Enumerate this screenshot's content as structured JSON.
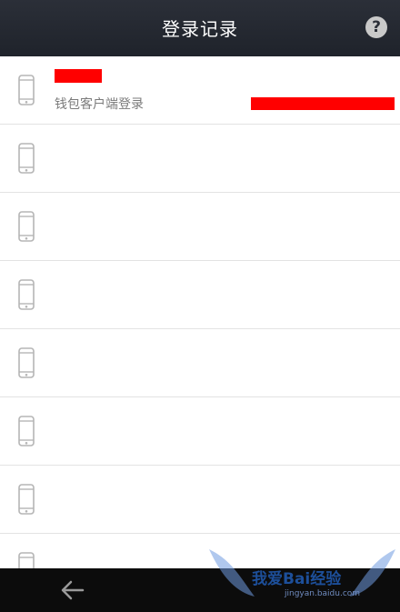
{
  "header": {
    "title": "登录记录",
    "help_label": "?"
  },
  "records": [
    {
      "subtitle": "钱包客户端登录",
      "has_redaction": true
    },
    {
      "subtitle": "",
      "has_redaction": false
    },
    {
      "subtitle": "",
      "has_redaction": false
    },
    {
      "subtitle": "",
      "has_redaction": false
    },
    {
      "subtitle": "",
      "has_redaction": false
    },
    {
      "subtitle": "",
      "has_redaction": false
    },
    {
      "subtitle": "",
      "has_redaction": false
    },
    {
      "subtitle": "",
      "has_redaction": false
    }
  ],
  "icons": {
    "record": "phone-icon",
    "back": "back-arrow-icon",
    "help": "help-icon"
  },
  "colors": {
    "header_bg": "#2b2f38",
    "redaction": "#ff0000",
    "bottom_bar": "#0c0c0c"
  },
  "watermark": {
    "text": "我爱Bai经验",
    "url": "jingyan.baidu.com"
  }
}
